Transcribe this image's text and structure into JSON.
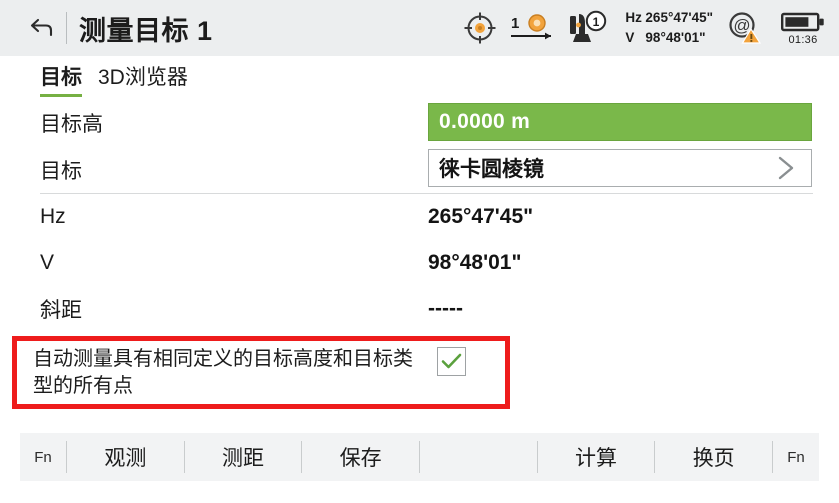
{
  "header": {
    "back_icon": "back-arrow-icon",
    "title": "测量目标 1",
    "status": {
      "target_lock_icon": "target-crosshair-icon",
      "prism_count_icon": "prism-1-icon",
      "prism_count_label": "1",
      "instrument_icon": "instrument-face-1-icon",
      "instrument_face_label": "1",
      "angles": [
        {
          "label": "Hz",
          "value": "265°47'45\""
        },
        {
          "label": "V",
          "value": "98°48'01\""
        }
      ],
      "connection_icon": "at-sign-warning-icon",
      "battery_icon": "battery-icon",
      "battery_time": "01:36"
    }
  },
  "tabs": [
    {
      "label": "目标",
      "active": true
    },
    {
      "label": "3D浏览器",
      "active": false
    }
  ],
  "form": {
    "rows": [
      {
        "label": "目标高",
        "field_type": "green",
        "value": "0.0000 m"
      },
      {
        "label": "目标",
        "field_type": "white",
        "value": "徕卡圆棱镜",
        "chevron_icon": "chevron-right-icon"
      },
      {
        "label": "Hz",
        "field_type": "text",
        "value": "265°47'45\""
      },
      {
        "label": "V",
        "field_type": "text",
        "value": "98°48'01\""
      },
      {
        "label": "斜距",
        "field_type": "text",
        "value": "-----"
      }
    ]
  },
  "highlight": {
    "text": "自动测量具有相同定义的目标高度和目标类型的所有点",
    "checkbox_checked": true,
    "checkbox_icon": "check-mark-icon",
    "border_color": "#ee1c1c"
  },
  "bottom_bar": {
    "fn_left": "Fn",
    "fn_right": "Fn",
    "keys": [
      {
        "label": "观测"
      },
      {
        "label": "测距"
      },
      {
        "label": "保存"
      },
      {
        "label": ""
      },
      {
        "label": "计算"
      },
      {
        "label": "换页"
      }
    ]
  },
  "colors": {
    "accent_green": "#7ab84a",
    "tab_underline": "#76b043",
    "highlight_red": "#ee1c1c",
    "header_bg": "#eceeef",
    "icon_orange": "#f2a33c"
  }
}
